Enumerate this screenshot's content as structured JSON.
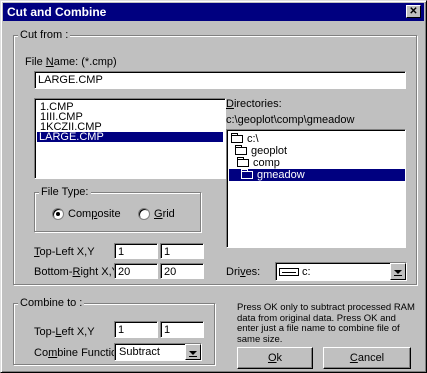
{
  "window": {
    "title": "Cut and Combine",
    "close_glyph": "✕"
  },
  "cut_from": {
    "legend": "Cut from :",
    "file_name_label_pre": "File ",
    "file_name_label_ul": "N",
    "file_name_label_post": "ame:  (*.cmp)",
    "file_name_value": "LARGE.CMP",
    "files": [
      "1.CMP",
      "1III.CMP",
      "1KCZII.CMP",
      "LARGE.CMP"
    ],
    "selected_file_index": 3,
    "directories_label_ul": "D",
    "directories_label_post": "irectories:",
    "current_path": "c:\\geoplot\\comp\\gmeadow",
    "directories": [
      "c:\\",
      "geoplot",
      "comp",
      "gmeadow"
    ],
    "selected_directory_index": 3,
    "file_type": {
      "legend": "File Type:",
      "composite_label_pre": "Com",
      "composite_label_ul": "p",
      "composite_label_post": "osite",
      "grid_label_ul": "G",
      "grid_label_post": "rid",
      "selected": "composite"
    },
    "top_left_label_ul": "T",
    "top_left_label_post": "op-Left X,Y",
    "top_left_x": "1",
    "top_left_y": "1",
    "bottom_right_label_pre": "Bottom-",
    "bottom_right_label_ul": "R",
    "bottom_right_label_post": "ight X,Y",
    "bottom_right_x": "20",
    "bottom_right_y": "20",
    "drives_label_pre": "Dri",
    "drives_label_ul": "v",
    "drives_label_post": "es:",
    "drive_value": "c:"
  },
  "combine_to": {
    "legend": "Combine to :",
    "top_left_label_pre": "Top-",
    "top_left_label_ul": "L",
    "top_left_label_post": "eft X,Y",
    "top_left_x": "1",
    "top_left_y": "1",
    "function_label_pre": "Co",
    "function_label_ul": "m",
    "function_label_post": "bine Function",
    "function_value": "Subtract"
  },
  "help_text": "Press OK only to subtract processed RAM data from original data. Press OK and enter just a file name to combine file of same size.",
  "buttons": {
    "ok_ul": "O",
    "ok_post": "k",
    "cancel_ul": "C",
    "cancel_post": "ancel"
  }
}
